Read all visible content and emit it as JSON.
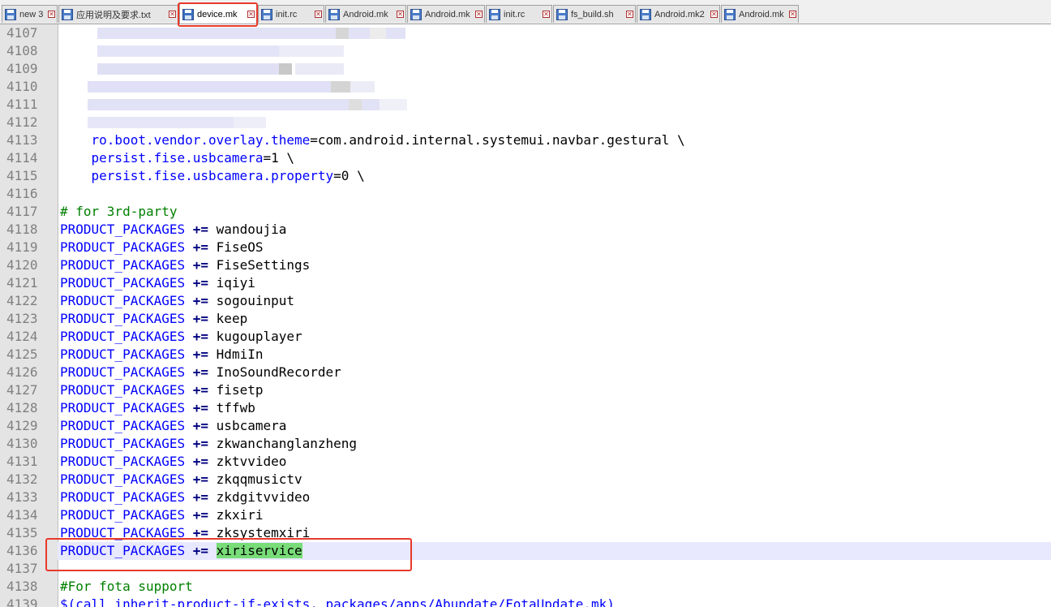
{
  "tabs": [
    {
      "label": "new 3",
      "active": false
    },
    {
      "label": "应用说明及要求.txt",
      "active": false
    },
    {
      "label": "device.mk",
      "active": true
    },
    {
      "label": "init.rc",
      "active": false
    },
    {
      "label": "Android.mk",
      "active": false
    },
    {
      "label": "Android.mk",
      "active": false
    },
    {
      "label": "init.rc",
      "active": false
    },
    {
      "label": "fs_build.sh",
      "active": false
    },
    {
      "label": "Android.mk2",
      "active": false
    },
    {
      "label": "Android.mk",
      "active": false
    }
  ],
  "colors": {
    "keyword": "#0000ff",
    "comment": "#008000",
    "highlight": "#78dc78",
    "annotation": "#e8392a",
    "current_line": "#e8e8ff"
  },
  "editor": {
    "current_line": "4136",
    "lines": [
      {
        "n": "4107",
        "type": "blur"
      },
      {
        "n": "4108",
        "type": "blur"
      },
      {
        "n": "4109",
        "type": "blur"
      },
      {
        "n": "4110",
        "type": "blur"
      },
      {
        "n": "4111",
        "type": "blur"
      },
      {
        "n": "4112",
        "type": "blur"
      },
      {
        "n": "4113",
        "type": "prop",
        "key": "ro.boot.vendor.overlay.theme",
        "eq": "=",
        "value": "com.android.internal.systemui.navbar.gestural \\"
      },
      {
        "n": "4114",
        "type": "prop",
        "key": "persist.fise.usbcamera",
        "eq": "=",
        "value": "1 \\"
      },
      {
        "n": "4115",
        "type": "prop",
        "key": "persist.fise.usbcamera.property",
        "eq": "=",
        "value": "0 \\"
      },
      {
        "n": "4116",
        "type": "empty"
      },
      {
        "n": "4117",
        "type": "comment",
        "text": "# for 3rd-party"
      },
      {
        "n": "4118",
        "type": "pkg",
        "var": "PRODUCT_PACKAGES",
        "op": "+=",
        "value": "wandoujia"
      },
      {
        "n": "4119",
        "type": "pkg",
        "var": "PRODUCT_PACKAGES",
        "op": "+=",
        "value": "FiseOS"
      },
      {
        "n": "4120",
        "type": "pkg",
        "var": "PRODUCT_PACKAGES",
        "op": "+=",
        "value": "FiseSettings"
      },
      {
        "n": "4121",
        "type": "pkg",
        "var": "PRODUCT_PACKAGES",
        "op": "+=",
        "value": "iqiyi"
      },
      {
        "n": "4122",
        "type": "pkg",
        "var": "PRODUCT_PACKAGES",
        "op": "+=",
        "value": "sogouinput"
      },
      {
        "n": "4123",
        "type": "pkg",
        "var": "PRODUCT_PACKAGES",
        "op": "+=",
        "value": "keep"
      },
      {
        "n": "4124",
        "type": "pkg",
        "var": "PRODUCT_PACKAGES",
        "op": "+=",
        "value": "kugouplayer"
      },
      {
        "n": "4125",
        "type": "pkg",
        "var": "PRODUCT_PACKAGES",
        "op": "+=",
        "value": "HdmiIn"
      },
      {
        "n": "4126",
        "type": "pkg",
        "var": "PRODUCT_PACKAGES",
        "op": "+=",
        "value": "InoSoundRecorder"
      },
      {
        "n": "4127",
        "type": "pkg",
        "var": "PRODUCT_PACKAGES",
        "op": "+=",
        "value": "fisetp"
      },
      {
        "n": "4128",
        "type": "pkg",
        "var": "PRODUCT_PACKAGES",
        "op": "+=",
        "value": "tffwb"
      },
      {
        "n": "4129",
        "type": "pkg",
        "var": "PRODUCT_PACKAGES",
        "op": "+=",
        "value": "usbcamera"
      },
      {
        "n": "4130",
        "type": "pkg",
        "var": "PRODUCT_PACKAGES",
        "op": "+=",
        "value": "zkwanchanglanzheng"
      },
      {
        "n": "4131",
        "type": "pkg",
        "var": "PRODUCT_PACKAGES",
        "op": "+=",
        "value": "zktvvideo"
      },
      {
        "n": "4132",
        "type": "pkg",
        "var": "PRODUCT_PACKAGES",
        "op": "+=",
        "value": "zkqqmusictv"
      },
      {
        "n": "4133",
        "type": "pkg",
        "var": "PRODUCT_PACKAGES",
        "op": "+=",
        "value": "zkdgitvvideo"
      },
      {
        "n": "4134",
        "type": "pkg",
        "var": "PRODUCT_PACKAGES",
        "op": "+=",
        "value": "zkxiri"
      },
      {
        "n": "4135",
        "type": "pkg",
        "var": "PRODUCT_PACKAGES",
        "op": "+=",
        "value": "zksystemxiri"
      },
      {
        "n": "4136",
        "type": "pkg",
        "var": "PRODUCT_PACKAGES",
        "op": "+=",
        "value": "xiriservice",
        "highlight": true
      },
      {
        "n": "4137",
        "type": "empty"
      },
      {
        "n": "4138",
        "type": "comment",
        "text": "#For fota support"
      },
      {
        "n": "4139",
        "type": "call",
        "text": "$(call inherit-product-if-exists, packages/apps/Abupdate/FotaUpdate.mk)"
      }
    ]
  }
}
